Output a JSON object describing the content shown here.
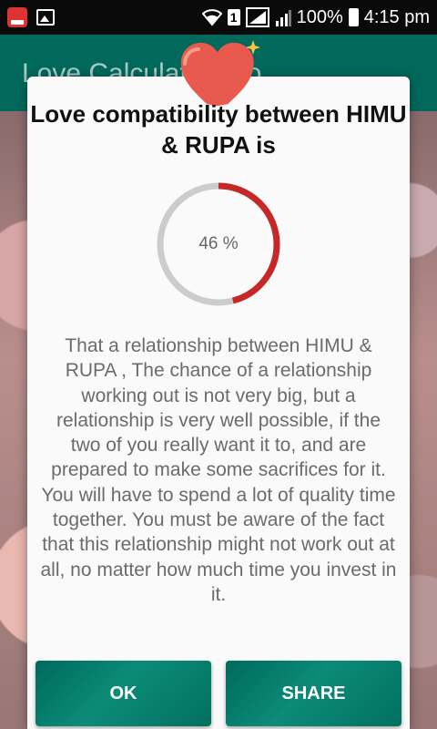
{
  "status_bar": {
    "battery": "100%",
    "time": "4:15 pm",
    "sim_slot": "1",
    "notification_icons": [
      "app-notification-icon",
      "gallery-icon"
    ],
    "system_icons": [
      "wifi-icon",
      "sim-signal-icon",
      "signal-icon",
      "battery-charging-icon"
    ]
  },
  "app_bar": {
    "title": "Love Calculator Pro"
  },
  "dialog": {
    "icon": "heart-icon",
    "title": "Love compatibility between HIMU & RUPA is",
    "percentage_text": "46 %",
    "percentage_value": 46,
    "message": "That a relationship between HIMU & RUPA , The chance of a relationship working out is not very big, but a relationship is very well possible, if the two of you really want it to, and are prepared to make some sacrifices for it. You will have to spend a lot of quality time together. You must be aware of the fact that this relationship might not work out at all, no matter how much time you invest in it.",
    "buttons": {
      "ok": "OK",
      "share": "SHARE"
    }
  },
  "colors": {
    "primary": "#00695c",
    "progress": "#c62828",
    "track": "#cccccc",
    "heart": "#e95a4e"
  }
}
